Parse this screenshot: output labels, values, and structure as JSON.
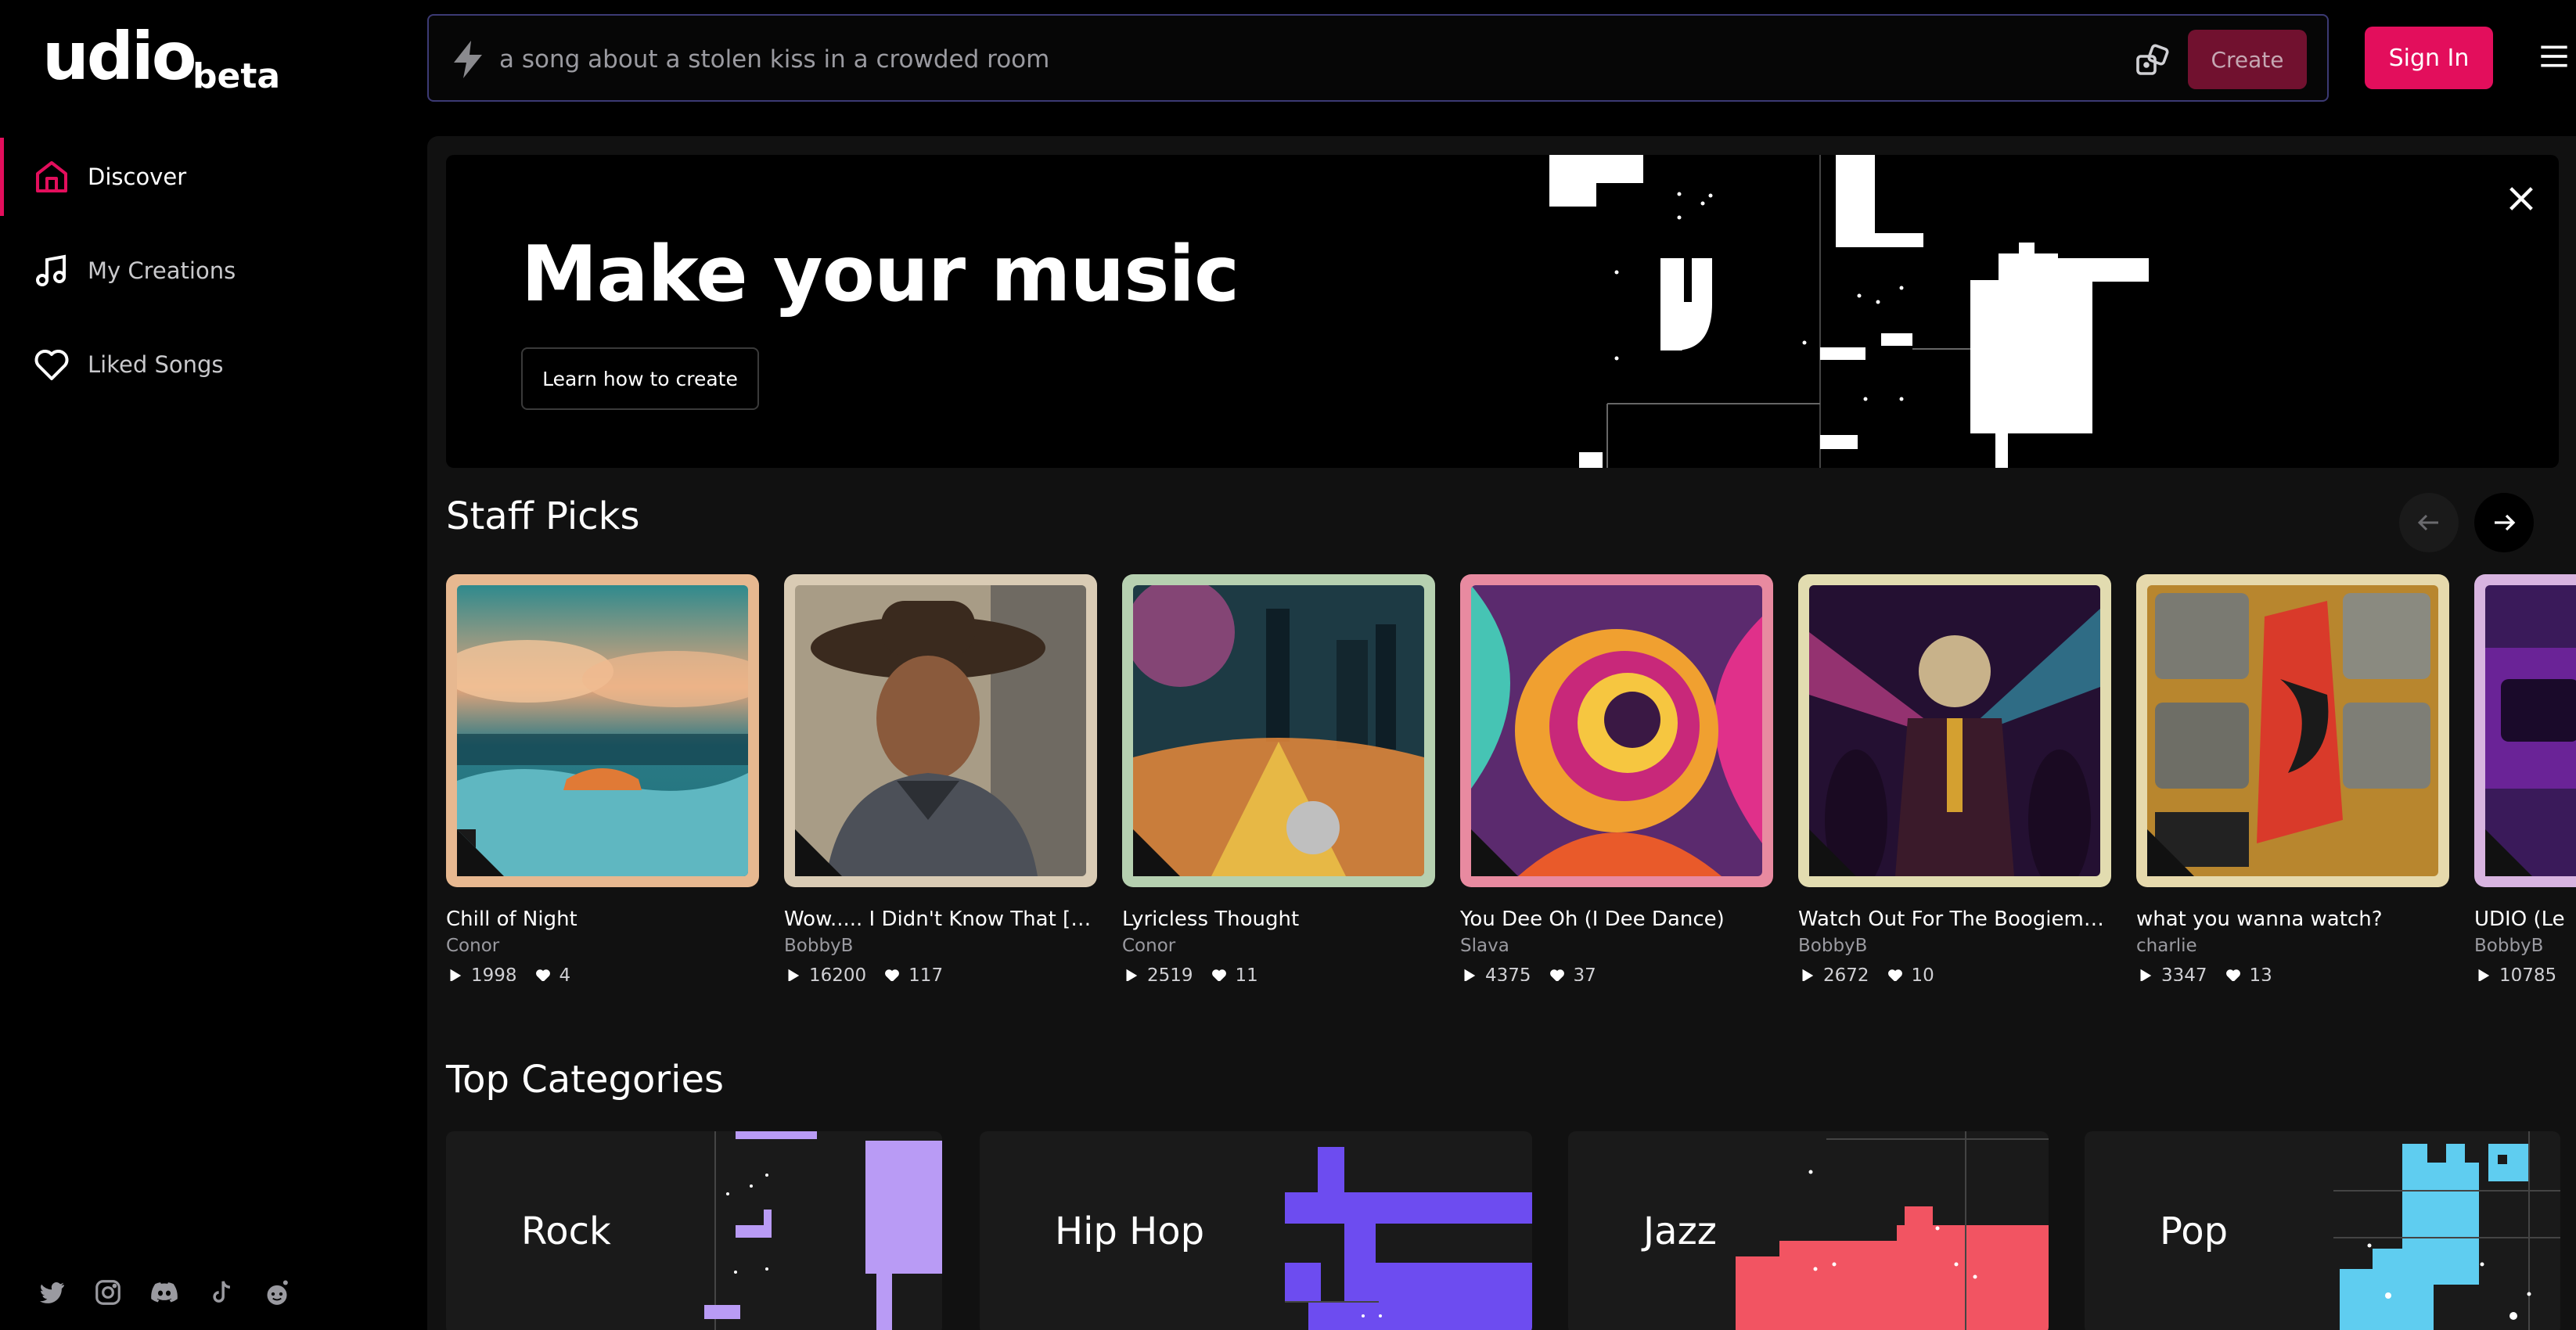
{
  "app": {
    "logo": "udio",
    "logo_badge": "beta"
  },
  "sidebar": {
    "items": [
      {
        "label": "Discover",
        "icon": "home-icon",
        "active": true
      },
      {
        "label": "My Creations",
        "icon": "music-note-icon",
        "active": false
      },
      {
        "label": "Liked Songs",
        "icon": "heart-icon",
        "active": false
      }
    ],
    "socials": [
      "twitter-icon",
      "instagram-icon",
      "discord-icon",
      "tiktok-icon",
      "reddit-icon"
    ]
  },
  "search": {
    "placeholder": "a song about a stolen kiss in a crowded room",
    "value": ""
  },
  "toolbar": {
    "create_label": "Create",
    "signin_label": "Sign In"
  },
  "banner": {
    "title": "Make your music",
    "button_label": "Learn how to create"
  },
  "staff_picks": {
    "title": "Staff Picks",
    "cards": [
      {
        "title": "Chill of Night",
        "artist": "Conor",
        "plays": "1998",
        "likes": "4",
        "frame": "#e7b890"
      },
      {
        "title": "Wow..... I Didn't Know That [Full...",
        "artist": "BobbyB",
        "plays": "16200",
        "likes": "117",
        "frame": "#d9cbb4"
      },
      {
        "title": "Lyricless Thought",
        "artist": "Conor",
        "plays": "2519",
        "likes": "11",
        "frame": "#b6d0b0"
      },
      {
        "title": "You Dee Oh (I Dee Dance)",
        "artist": "Slava",
        "plays": "4375",
        "likes": "37",
        "frame": "#e88aa0"
      },
      {
        "title": "Watch Out For The Boogieman, ...",
        "artist": "BobbyB",
        "plays": "2672",
        "likes": "10",
        "frame": "#e2dcb0"
      },
      {
        "title": "what you wanna watch?",
        "artist": "charlie",
        "plays": "3347",
        "likes": "13",
        "frame": "#e6d9ac"
      },
      {
        "title": "UDIO (Le",
        "artist": "BobbyB",
        "plays": "10785",
        "likes": "",
        "frame": "#d8b4e0"
      }
    ]
  },
  "top_categories": {
    "title": "Top Categories",
    "items": [
      {
        "label": "Rock",
        "color": "#b99bf5"
      },
      {
        "label": "Hip Hop",
        "color": "#6d4cf0"
      },
      {
        "label": "Jazz",
        "color": "#f25462"
      },
      {
        "label": "Pop",
        "color": "#5fcdf0"
      }
    ]
  },
  "colors": {
    "accent": "#e30e5c",
    "create_disabled": "#71112f",
    "search_border": "#3c3a74"
  }
}
